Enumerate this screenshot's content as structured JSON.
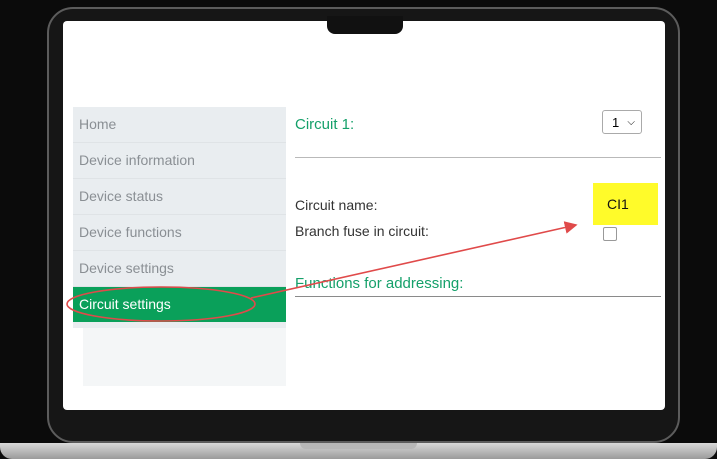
{
  "sidebar": {
    "items": [
      {
        "label": "Home"
      },
      {
        "label": "Device information"
      },
      {
        "label": "Device status"
      },
      {
        "label": "Device functions"
      },
      {
        "label": "Device settings"
      },
      {
        "label": "Circuit settings",
        "active": true
      }
    ]
  },
  "main": {
    "circuit_title": "Circuit 1:",
    "circuit_select_value": "1",
    "circuit_name_label": "Circuit name:",
    "circuit_name_value": "CI1",
    "branch_fuse_label": "Branch fuse in circuit:",
    "branch_fuse_checked": false,
    "addressing_heading": "Functions for addressing:"
  },
  "colors": {
    "accent_green": "#0aa05a",
    "heading_green": "#15a06a",
    "highlight_yellow": "#fffb2a",
    "annotation_red": "#e04a4a"
  }
}
